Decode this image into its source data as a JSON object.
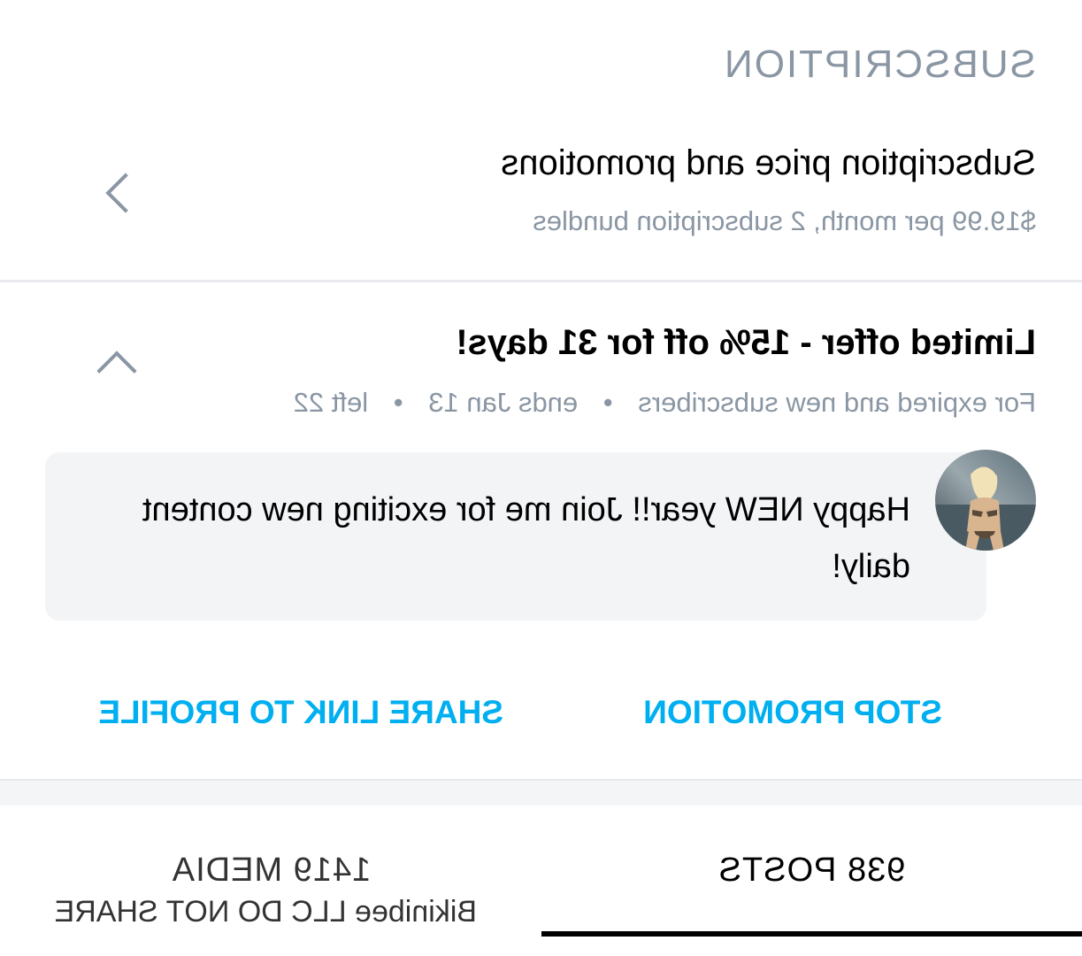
{
  "section": {
    "title": "SUBSCRIPTION"
  },
  "subscription_row": {
    "title": "Subscription price and promotions",
    "subtitle": "$19.99 per month, 2 subscription bundles"
  },
  "promo": {
    "title": "Limited offer - 15% off for 31 days!",
    "meta_audience": "For expired and new subscribers",
    "meta_ends": "ends Jan 13",
    "meta_left": "left 22",
    "separator": "•",
    "message": "Happy NEW year!! Join me for exciting new content daily!"
  },
  "actions": {
    "stop_label": "STOP PROMOTION",
    "share_label": "SHARE LINK TO PROFILE"
  },
  "tabs": [
    {
      "label": "938 POSTS",
      "active": true
    },
    {
      "label": "1419 MEDIA",
      "active": false
    }
  ],
  "watermark": "Bikinibee LLC DO NOT SHARE",
  "colors": {
    "accent": "#00aff0",
    "muted": "#8a96a3",
    "bubble": "#f2f4f6",
    "divider": "#e8eaed"
  },
  "icons": {
    "collapse": "chevron-up-icon",
    "open": "chevron-right-icon"
  }
}
